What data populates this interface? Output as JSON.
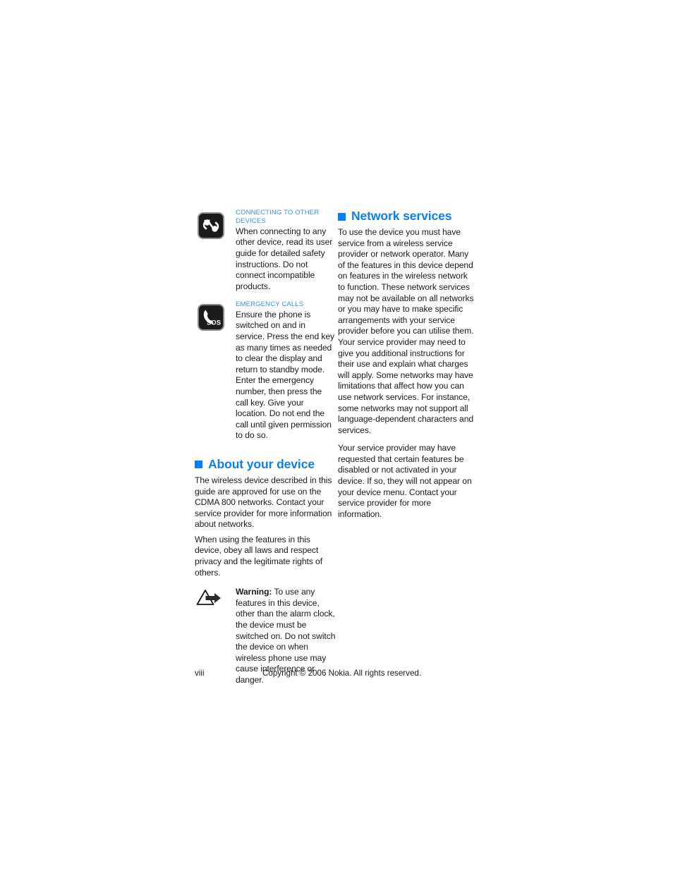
{
  "document": {
    "page_number": "viii",
    "copyright": "Copyright © 2006 Nokia. All rights reserved.",
    "accent_color": "#0080ff",
    "label_color": "#3b90ef",
    "text_color": "#1a1a1a"
  },
  "left_column": {
    "notes": [
      {
        "icon": "connector-plug-icon",
        "label": "CONNECTING TO OTHER DEVICES",
        "body": "When connecting to any other device, read its user guide for detailed safety instructions. Do not connect incompatible products."
      },
      {
        "icon": "sos-handset-icon",
        "label": "EMERGENCY CALLS",
        "body": "Ensure the phone is switched on and in service. Press the end key as many times as needed to clear the display and return to standby mode. Enter the emergency number, then press the call key. Give your location. Do not end the call until given permission to do so."
      }
    ],
    "section": {
      "bullet": "square-bullet-icon",
      "heading": "About your device",
      "paragraphs": [
        "The wireless device described in this guide are approved for use on the CDMA 800 networks. Contact your service provider for more information about networks.",
        "When using the features in this device, obey all laws and respect privacy and the legitimate rights of others."
      ],
      "warning": {
        "icon": "warning-triangle-arrow-icon",
        "lead": "Warning:",
        "body": " To use any features in this device, other than the alarm clock, the device must be switched on. Do not switch the device on when wireless phone use may cause interference or danger."
      }
    }
  },
  "right_column": {
    "section": {
      "bullet": "square-bullet-icon",
      "heading": "Network services",
      "paragraphs": [
        "To use the device you must have service from a wireless service provider or network operator. Many of the features in this device depend on features in the wireless network to function. These network services may not be available on all networks or you may have to make specific arrangements with your service provider before you can utilise them. Your service provider may need to give you additional instructions for their use and explain what charges will apply. Some networks may have limitations that affect how you can use network services. For instance, some networks may not support all language-dependent characters and services.",
        "Your service provider may have requested that certain features be disabled or not activated in your device. If so, they will not appear on your device menu. Contact your service provider for more information."
      ]
    }
  }
}
